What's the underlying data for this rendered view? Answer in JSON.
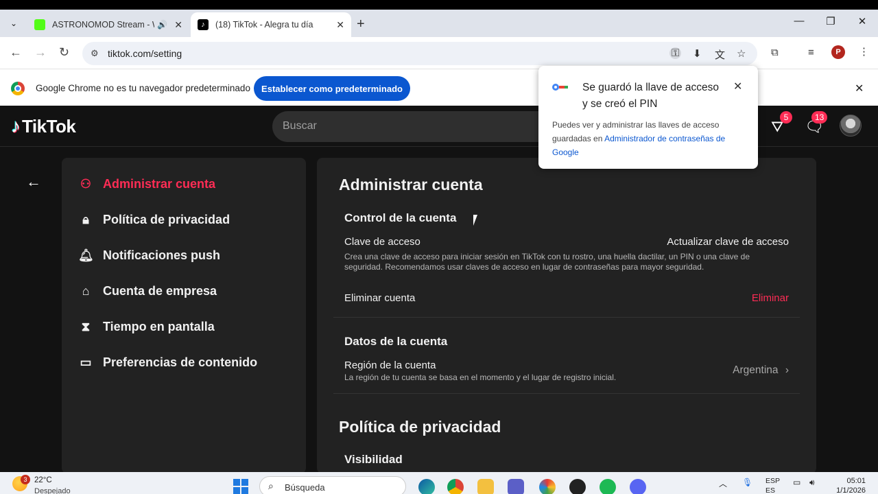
{
  "browser": {
    "tabs": [
      {
        "title": "ASTRONOMOD Stream - W",
        "favicon_color": "#53fc18"
      },
      {
        "title": "(18) TikTok - Alegra tu día",
        "favicon_color": "#000000"
      }
    ],
    "url": "tiktok.com/setting",
    "profile_initial": "P"
  },
  "infobar": {
    "message": "Google Chrome no es tu navegador predeterminado",
    "button": "Establecer como predeterminado"
  },
  "popup": {
    "title": "Se guardó la llave de acceso y se creó el PIN",
    "body": "Puedes ver y administrar las llaves de acceso guardadas en ",
    "link": "Administrador de contraseñas de Google"
  },
  "header": {
    "logo": "TikTok",
    "search_placeholder": "Buscar",
    "inbox_badge": "5",
    "messages_badge": "13"
  },
  "sidebar": {
    "items": [
      {
        "label": "Administrar cuenta",
        "icon": "person-icon",
        "active": true
      },
      {
        "label": "Política de privacidad",
        "icon": "lock-icon",
        "active": false
      },
      {
        "label": "Notificaciones push",
        "icon": "bell-icon",
        "active": false
      },
      {
        "label": "Cuenta de empresa",
        "icon": "store-icon",
        "active": false
      },
      {
        "label": "Tiempo en pantalla",
        "icon": "hourglass-icon",
        "active": false
      },
      {
        "label": "Preferencias de contenido",
        "icon": "video-icon",
        "active": false
      }
    ]
  },
  "content": {
    "title": "Administrar cuenta",
    "control": {
      "heading": "Control de la cuenta",
      "passkey_label": "Clave de acceso",
      "passkey_action": "Actualizar clave de acceso",
      "passkey_desc": "Crea una clave de acceso para iniciar sesión en TikTok con tu rostro, una huella dactilar, un PIN o una clave de seguridad. Recomendamos usar claves de acceso en lugar de contraseñas para mayor seguridad.",
      "delete_label": "Eliminar cuenta",
      "delete_action": "Eliminar"
    },
    "data": {
      "heading": "Datos de la cuenta",
      "region_label": "Región de la cuenta",
      "region_desc": "La región de tu cuenta se basa en el momento y el lugar de registro inicial.",
      "region_value": "Argentina"
    },
    "privacy": {
      "title": "Política de privacidad",
      "visibility": "Visibilidad"
    }
  },
  "taskbar": {
    "weather_badge": "3",
    "temp": "22°C",
    "weather": "Despejado",
    "search": "Búsqueda",
    "lang_top": "ESP",
    "lang_bottom": "ES",
    "time": "05:01",
    "date": "1/1/2026"
  }
}
